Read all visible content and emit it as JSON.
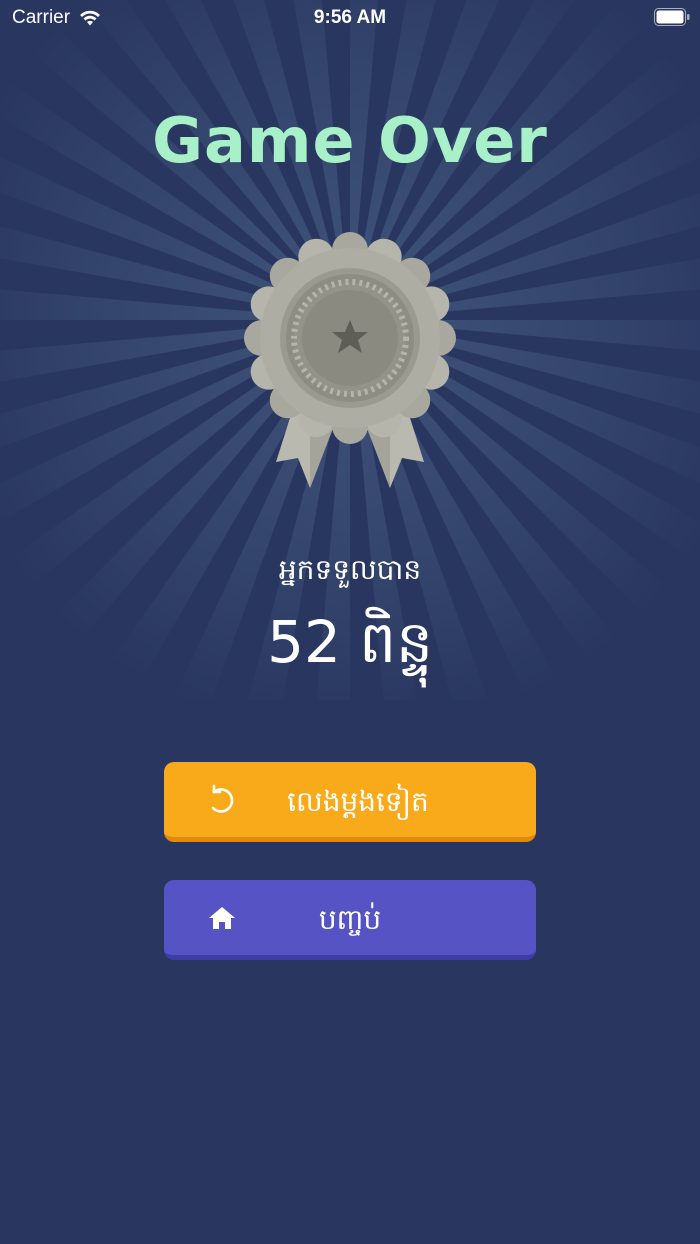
{
  "status_bar": {
    "carrier": "Carrier",
    "time": "9:56 AM",
    "wifi_icon": "wifi-icon",
    "battery_icon": "battery-icon"
  },
  "title": "Game Over",
  "medal": {
    "icon": "silver-medal-icon",
    "star_icon": "star-icon"
  },
  "result": {
    "earned_label": "អ្នកទទួលបាន",
    "score_text": "52 ពិន្ទុ"
  },
  "buttons": {
    "replay": {
      "label": "លេងម្តងទៀត",
      "icon": "replay-icon",
      "color": "#f8aa1a"
    },
    "quit": {
      "label": "បញ្ចប់",
      "icon": "home-icon",
      "color": "#5654c4"
    }
  },
  "colors": {
    "background": "#283660",
    "title": "#a8f0c8"
  }
}
